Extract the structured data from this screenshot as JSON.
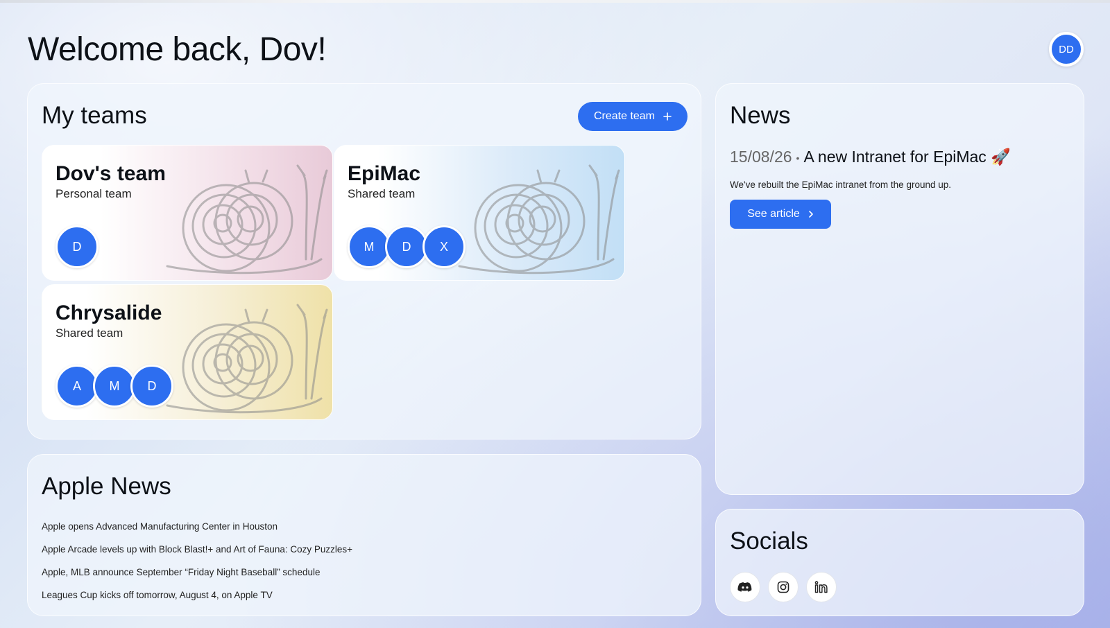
{
  "header": {
    "title": "Welcome back, Dov!",
    "avatar_initials": "DD"
  },
  "colors": {
    "accent": "#2d6ef0"
  },
  "teams": {
    "title": "My teams",
    "create_label": "Create team",
    "create_icon": "plus-icon",
    "items": [
      {
        "name": "Dov's team",
        "type": "Personal team",
        "members": [
          "D"
        ],
        "theme": "pink"
      },
      {
        "name": "EpiMac",
        "type": "Shared team",
        "members": [
          "M",
          "D",
          "X"
        ],
        "theme": "blue"
      },
      {
        "name": "Chrysalide",
        "type": "Shared team",
        "members": [
          "A",
          "M",
          "D"
        ],
        "theme": "yellow"
      }
    ]
  },
  "apple_news": {
    "title": "Apple News",
    "items": [
      "Apple opens Advanced Manufacturing Center in Houston",
      "Apple Arcade levels up with Block Blast!+ and Art of Fauna: Cozy Puzzles+",
      "Apple, MLB announce September “Friday Night Baseball” schedule",
      "Leagues Cup kicks off tomorrow, August 4, on Apple TV"
    ]
  },
  "news": {
    "title": "News",
    "date": "15/08/26",
    "separator": "•",
    "headline": "A new Intranet for EpiMac 🚀",
    "body": "We've rebuilt the EpiMac intranet from the ground up.",
    "button_label": "See article",
    "button_icon": "chevron-right-icon"
  },
  "socials": {
    "title": "Socials",
    "icons": [
      "discord-icon",
      "instagram-icon",
      "linkedin-icon"
    ]
  }
}
